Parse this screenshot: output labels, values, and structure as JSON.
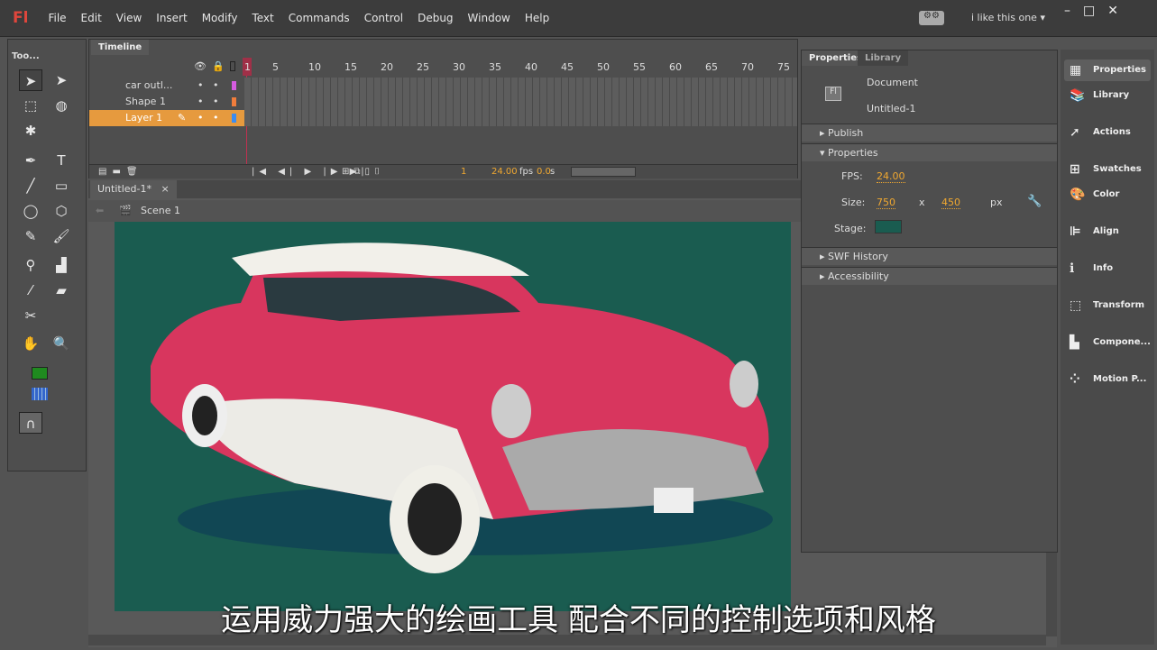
{
  "menubar": {
    "logo": "Fl",
    "items": [
      "File",
      "Edit",
      "View",
      "Insert",
      "Modify",
      "Text",
      "Commands",
      "Control",
      "Debug",
      "Window",
      "Help"
    ],
    "workspace": "i like this one"
  },
  "tools": {
    "title": "Too..."
  },
  "timeline": {
    "tab": "Timeline",
    "frame_numbers": [
      "1",
      "5",
      "10",
      "15",
      "20",
      "25",
      "30",
      "35",
      "40",
      "45",
      "50",
      "55",
      "60",
      "65",
      "70",
      "75"
    ],
    "layers": [
      {
        "name": "car outl...",
        "color": "#d65ce0"
      },
      {
        "name": "Shape 1",
        "color": "#f07d3c"
      },
      {
        "name": "Layer 1",
        "color": "#3c8cf0"
      }
    ],
    "current_frame": "1",
    "fps": "24.00",
    "fps_unit": "fps",
    "time": "0.0",
    "time_unit": "s"
  },
  "document": {
    "tab": "Untitled-1*",
    "close": "×",
    "scene": "Scene 1",
    "stage_color": "#1a5c50"
  },
  "properties": {
    "tabs": [
      "Properties",
      "Library"
    ],
    "doc_type": "Document",
    "doc_name": "Untitled-1",
    "sections": {
      "publish": "Publish",
      "properties": "Properties",
      "swf_history": "SWF History",
      "accessibility": "Accessibility"
    },
    "fps_label": "FPS:",
    "fps": "24.00",
    "size_label": "Size:",
    "width": "750",
    "x": "x",
    "height": "450",
    "unit": "px",
    "stage_label": "Stage:"
  },
  "dock": [
    "Properties",
    "Library",
    "Actions",
    "Swatches",
    "Color",
    "Align",
    "Info",
    "Transform",
    "Compone...",
    "Motion P..."
  ],
  "subtitle": "运用威力强大的绘画工具 配合不同的控制选项和风格"
}
